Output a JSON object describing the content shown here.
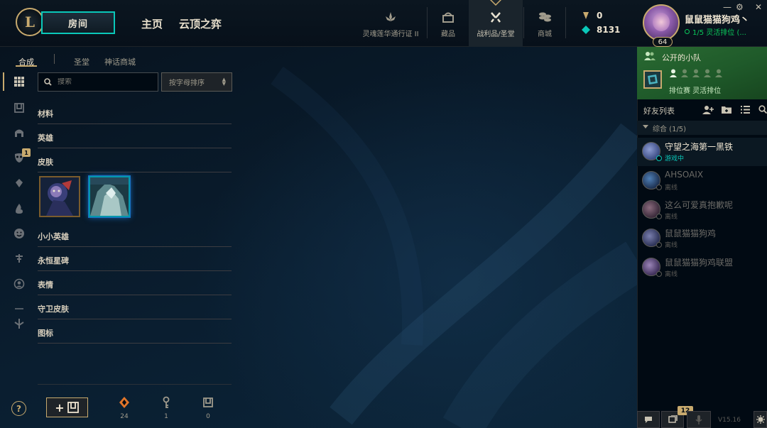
{
  "topbar": {
    "play_button_label": "房间",
    "nav_home": "主页",
    "nav_tft": "云顶之弈",
    "icon_items": [
      {
        "label": "灵魂莲华通行证 II",
        "icon": "lotus-icon"
      },
      {
        "label": "藏品",
        "icon": "collection-icon"
      },
      {
        "label": "战利品/圣堂",
        "icon": "loot-icon",
        "active": true
      },
      {
        "label": "商城",
        "icon": "store-icon"
      }
    ],
    "currency": {
      "rp": "0",
      "be": "8131"
    },
    "profile": {
      "name": "鼠鼠猫猫狗鸡丶",
      "level": "64",
      "status": "1/5 灵活排位 (..."
    }
  },
  "subtabs": {
    "crafting": "合成",
    "sanctum": "圣堂",
    "mythic_shop": "神话商城"
  },
  "sidebar": {
    "badge_count": "1"
  },
  "search": {
    "placeholder": "搜索"
  },
  "sort": {
    "selected": "按字母排序"
  },
  "categories": {
    "materials": "材料",
    "champions": "英雄",
    "skins": "皮肤",
    "tacticians": "小小英雄",
    "eternals": "永恒星碑",
    "emotes": "表情",
    "ward_skins": "守卫皮肤",
    "icons": "图标"
  },
  "resources": {
    "orange_essence": "24",
    "keys": "1",
    "chests": "0"
  },
  "social": {
    "party_title": "公开的小队",
    "party_mode": "排位赛 灵活排位",
    "friends_title": "好友列表",
    "group_label": "综合 (1/5)",
    "friends": [
      {
        "name": "守望之海第一黑铁",
        "status": "游戏中",
        "online": true
      },
      {
        "name": "AHSOAIX",
        "status": "离线",
        "online": false
      },
      {
        "name": "这么可爱真抱歉呢",
        "status": "离线",
        "online": false
      },
      {
        "name": "鼠鼠猫猫狗鸡",
        "status": "离线",
        "online": false
      },
      {
        "name": "鼠鼠猫猫狗鸡联盟",
        "status": "离线",
        "online": false
      }
    ],
    "notification_count": "12",
    "version": "V15.16"
  },
  "colors": {
    "gold": "#c8aa6e",
    "teal": "#0ac8b9",
    "party_green": "#2a6a32",
    "background": "#010a13"
  }
}
